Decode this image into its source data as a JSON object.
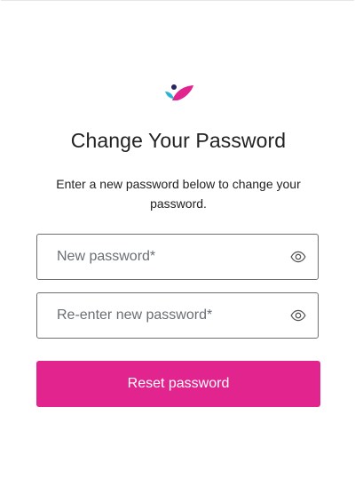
{
  "brand": {
    "logo_icon": "brand-logo-icon",
    "colors": {
      "primary": "#e2248f",
      "navy": "#2a2463",
      "teal": "#2bb3d6"
    }
  },
  "page": {
    "title": "Change Your Password",
    "description": "Enter a new password below to change your password."
  },
  "form": {
    "new_password": {
      "placeholder": "New password*",
      "value": "",
      "toggle_icon": "eye-icon"
    },
    "confirm_password": {
      "placeholder": "Re-enter new password*",
      "value": "",
      "toggle_icon": "eye-icon"
    },
    "submit_label": "Reset password"
  }
}
